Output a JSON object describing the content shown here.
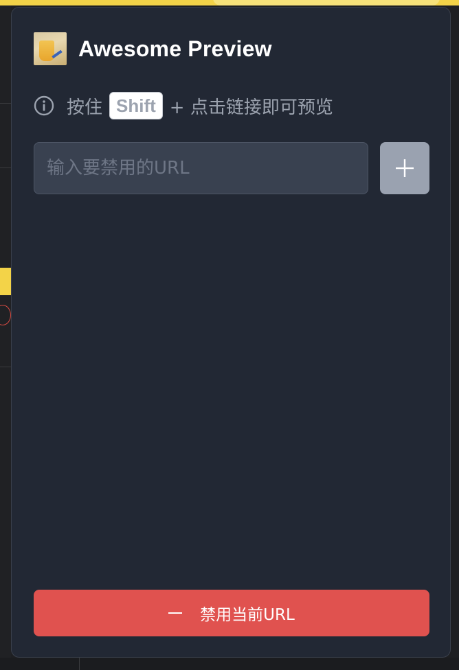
{
  "app": {
    "title": "Awesome Preview",
    "logo_icon": "drink-cup-icon"
  },
  "hint": {
    "icon": "info-icon",
    "prefix": "按住",
    "key": "Shift",
    "suffix": "+ 点击链接即可预览"
  },
  "url_input": {
    "value": "",
    "placeholder": "输入要禁用的URL"
  },
  "add_button": {
    "icon": "plus-icon"
  },
  "disable_button": {
    "icon": "minus-icon",
    "label": "禁用当前URL"
  },
  "colors": {
    "popup_background": "#222834",
    "input_background": "#394150",
    "add_button": "#9aa2b0",
    "danger": "#e0524f",
    "muted_text": "#9ca3af"
  }
}
